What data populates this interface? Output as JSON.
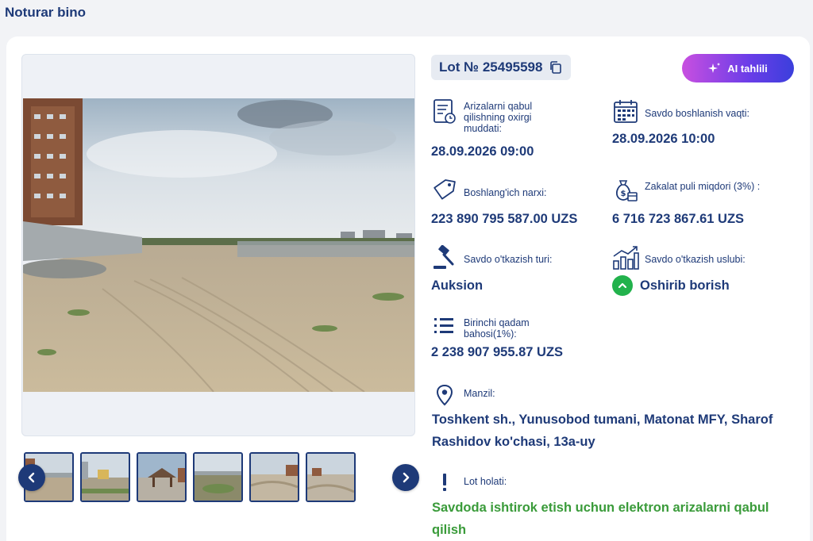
{
  "page": {
    "title": "Noturar bino"
  },
  "lot": {
    "number_label": "Lot № 25495598"
  },
  "ai_button": {
    "label": "AI tahlili"
  },
  "fields": {
    "deadline": {
      "label": "Arizalarni qabul qilishning oxirgi muddati:",
      "value": "28.09.2026 09:00",
      "icon": "document-clock-icon"
    },
    "start": {
      "label": "Savdo boshlanish vaqti:",
      "value": "28.09.2026 10:00",
      "icon": "calendar-icon"
    },
    "start_price": {
      "label": "Boshlang'ich narxi:",
      "value": "223 890 795 587.00 UZS",
      "icon": "price-tag-icon"
    },
    "deposit": {
      "label": "Zakalat puli miqdori (3%) :",
      "value": "6 716 723 867.61 UZS",
      "icon": "money-bag-icon"
    },
    "trade_type": {
      "label": "Savdo o'tkazish turi:",
      "value": "Auksion",
      "icon": "gavel-icon"
    },
    "trade_method": {
      "label": "Savdo o'tkazish uslubi:",
      "value": "Oshirib borish",
      "icon": "growth-chart-icon"
    },
    "first_step": {
      "label": "Birinchi qadam bahosi(1%):",
      "value": "2 238 907 955.87 UZS",
      "icon": "list-icon"
    },
    "address": {
      "label": "Manzil:",
      "value": "Toshkent sh., Yunusobod tumani, Matonat MFY, Sharof Rashidov ko'chasi, 13a-uy",
      "icon": "location-pin-icon"
    },
    "status": {
      "label": "Lot holati:",
      "value": "Savdoda ishtirok etish uchun elektron arizalarni qabul qilish",
      "icon": "exclamation-icon"
    }
  },
  "colors": {
    "primary": "#1e3a78",
    "status_green": "#3a9b3a",
    "method_green": "#22b24c",
    "ai_gradient_start": "#c84fe0",
    "ai_gradient_end": "#3b3fdc"
  }
}
